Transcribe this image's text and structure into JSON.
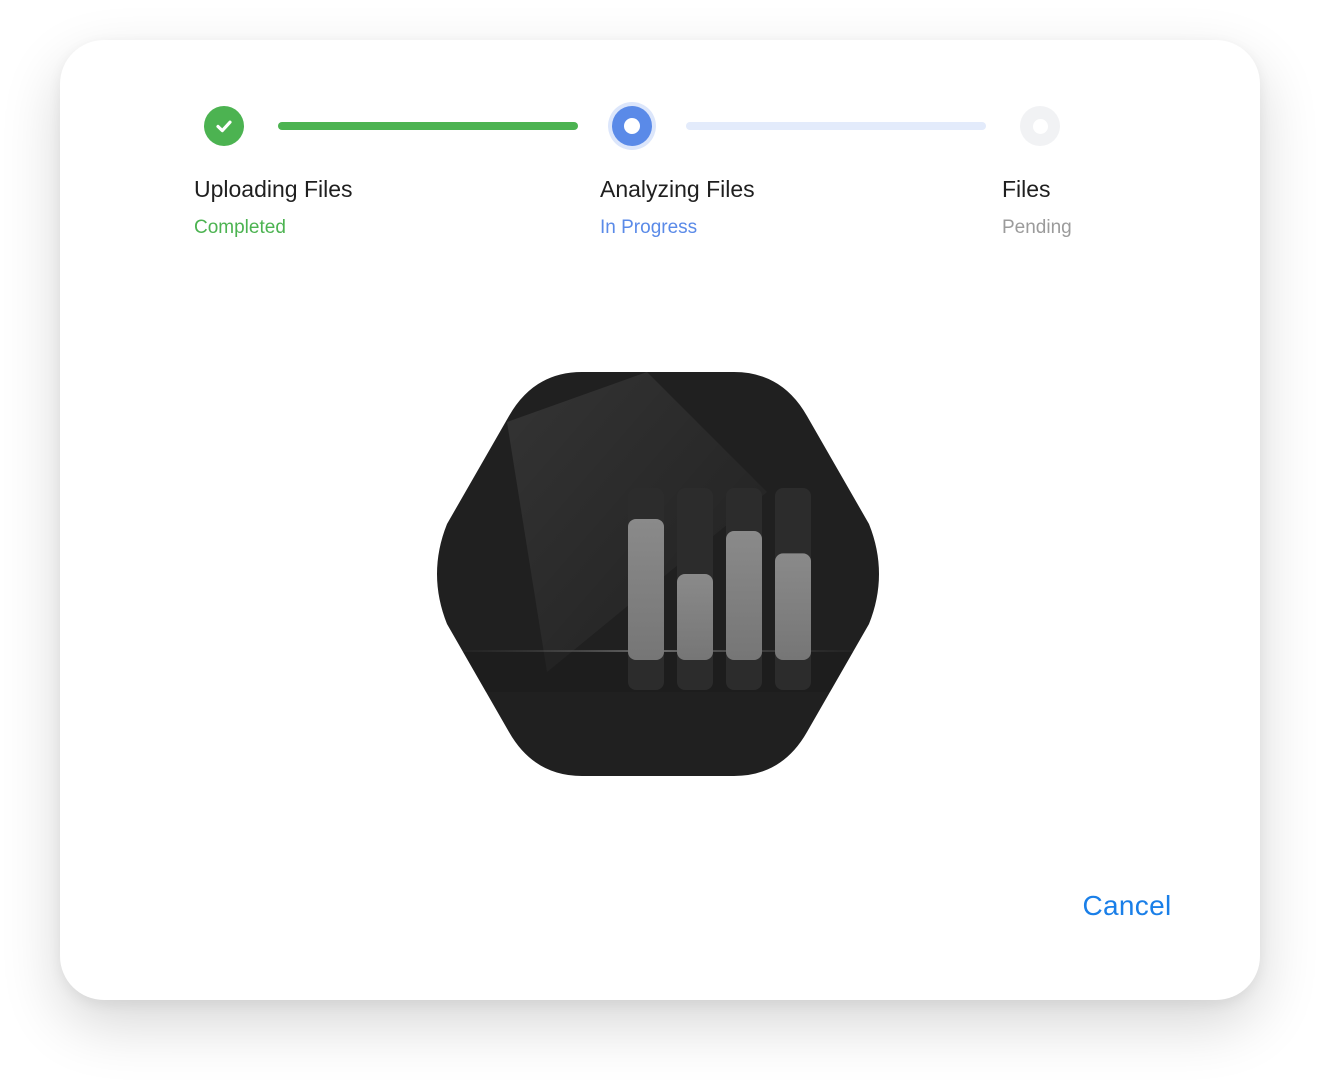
{
  "steps": [
    {
      "title": "Uploading Files",
      "status": "Completed",
      "state": "done",
      "icon": "check-icon",
      "color": "#4cb351"
    },
    {
      "title": "Analyzing Files",
      "status": "In Progress",
      "state": "active",
      "icon": "progress-dot-icon",
      "color": "#5a8ae8"
    },
    {
      "title": "Files",
      "status": "Pending",
      "state": "pending",
      "icon": "pending-dot-icon",
      "color": "#9b9b9b"
    }
  ],
  "connectors": [
    {
      "state": "done",
      "color": "#4cb351"
    },
    {
      "state": "pending",
      "color": "#e3ebfb"
    }
  ],
  "illustration": {
    "icon": "analyzing-bars-icon",
    "bar_levels": [
      0.82,
      0.5,
      0.75,
      0.62
    ]
  },
  "actions": {
    "cancel_label": "Cancel",
    "accent_color": "#1a7fe8"
  }
}
